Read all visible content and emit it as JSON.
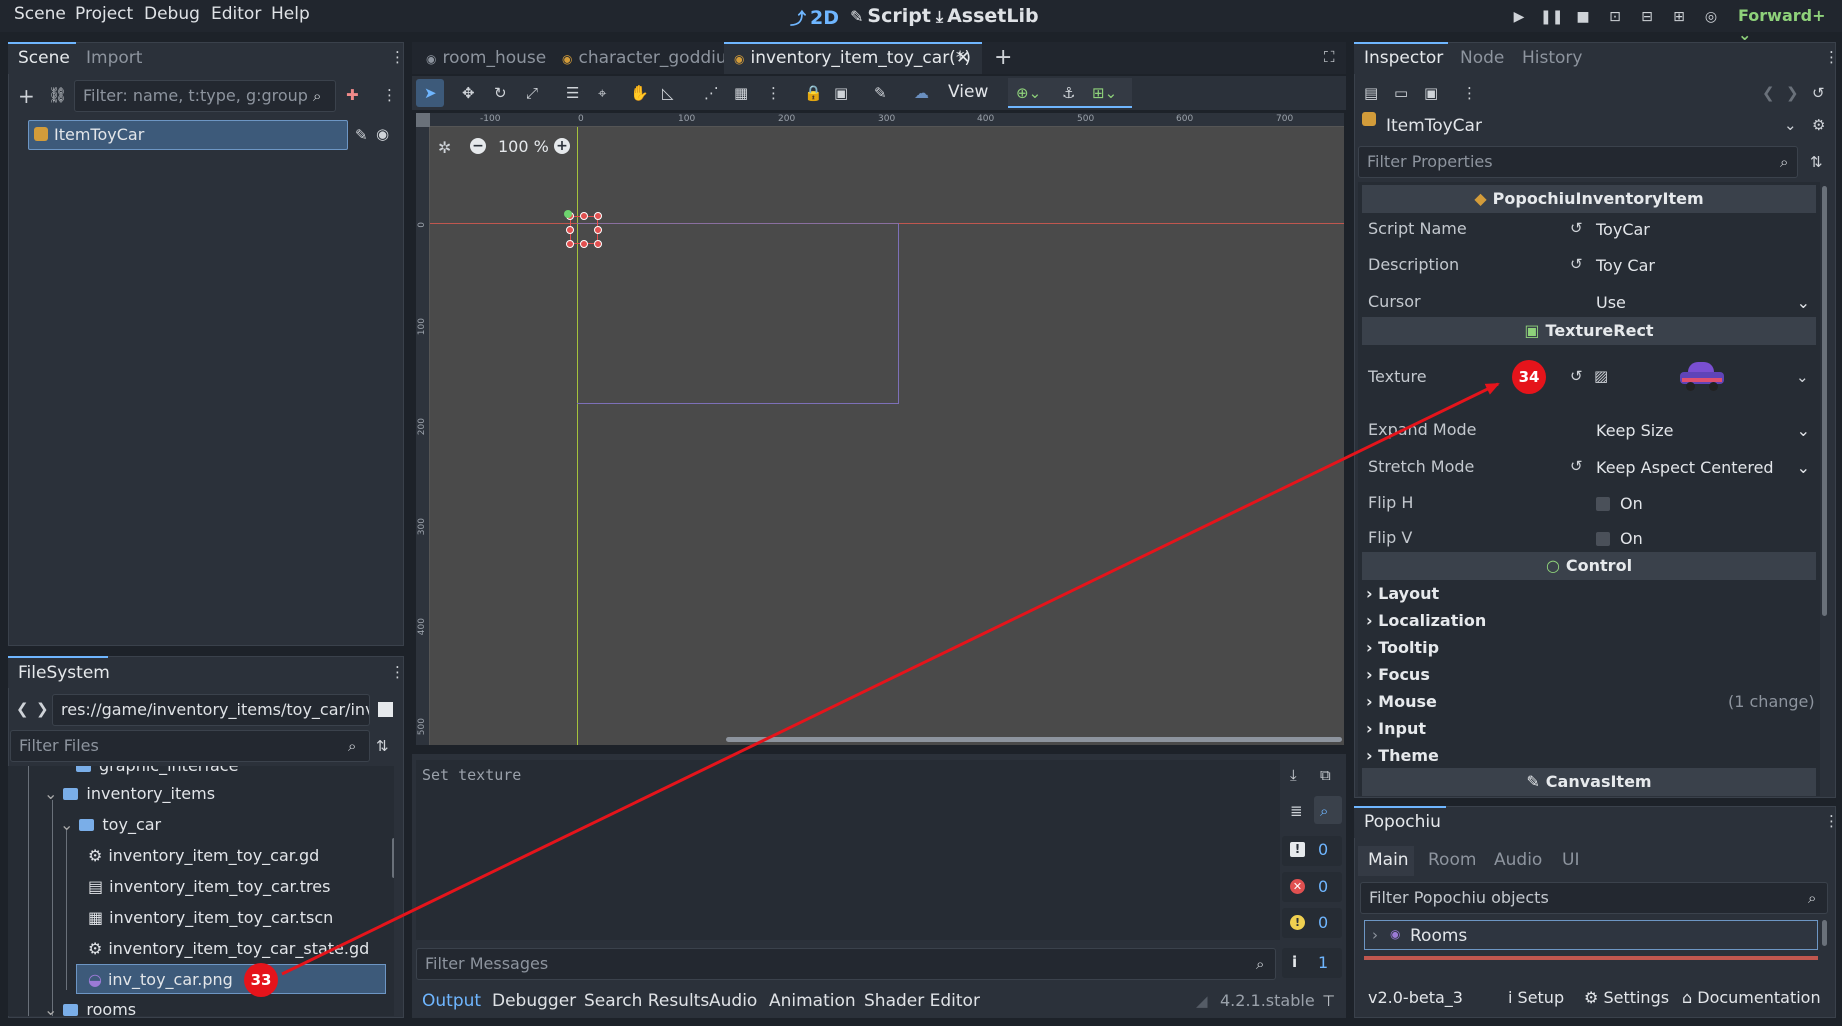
{
  "menu": [
    "Scene",
    "Project",
    "Debug",
    "Editor",
    "Help"
  ],
  "workspaces": [
    {
      "label": "2D",
      "icon": "2d-icon",
      "active": true
    },
    {
      "label": "Script",
      "icon": "script-icon",
      "active": false
    },
    {
      "label": "AssetLib",
      "icon": "assetlib-icon",
      "active": false
    }
  ],
  "renderer": "Forward+",
  "scene_dock": {
    "tabs": [
      "Scene",
      "Import"
    ],
    "filter_placeholder": "Filter: name, t:type, g:group",
    "root_node": "ItemToyCar"
  },
  "filesystem": {
    "title": "FileSystem",
    "path": "res://game/inventory_items/toy_car/inv_",
    "filter_placeholder": "Filter Files",
    "items": [
      {
        "label": "graphic_interface",
        "type": "folder"
      },
      {
        "label": "inventory_items",
        "type": "folder"
      },
      {
        "label": "toy_car",
        "type": "folder"
      },
      {
        "label": "inventory_item_toy_car.gd",
        "type": "script"
      },
      {
        "label": "inventory_item_toy_car.tres",
        "type": "resource"
      },
      {
        "label": "inventory_item_toy_car.tscn",
        "type": "scene"
      },
      {
        "label": "inventory_item_toy_car_state.gd",
        "type": "script"
      },
      {
        "label": "inv_toy_car.png",
        "type": "image",
        "selected": true
      },
      {
        "label": "rooms",
        "type": "folder"
      }
    ]
  },
  "editor_tabs": [
    {
      "label": "room_house",
      "active": false
    },
    {
      "label": "character_goddiu",
      "active": false
    },
    {
      "label": "inventory_item_toy_car(*)",
      "active": true
    }
  ],
  "toolbar": {
    "view_label": "View"
  },
  "zoom": "100 %",
  "ruler_h": [
    "-100",
    "0",
    "100",
    "200",
    "300",
    "400",
    "500",
    "600",
    "700"
  ],
  "ruler_v": [
    "0",
    "100",
    "200",
    "300",
    "400",
    "500"
  ],
  "output": {
    "text": "Set texture",
    "filter_placeholder": "Filter Messages",
    "counts": [
      "0",
      "0",
      "0",
      "1"
    ]
  },
  "bottom_tabs": [
    "Output",
    "Debugger",
    "Search Results",
    "Audio",
    "Animation",
    "Shader Editor"
  ],
  "version": "4.2.1.stable",
  "inspector": {
    "tabs": [
      "Inspector",
      "Node",
      "History"
    ],
    "node_name": "ItemToyCar",
    "filter_placeholder": "Filter Properties",
    "sections": {
      "popochiu": "PopochiuInventoryItem",
      "texture_rect": "TextureRect",
      "control": "Control",
      "canvas_item": "CanvasItem"
    },
    "props": {
      "script_name": {
        "label": "Script Name",
        "value": "ToyCar"
      },
      "description": {
        "label": "Description",
        "value": "Toy Car"
      },
      "cursor": {
        "label": "Cursor",
        "value": "Use"
      },
      "texture": {
        "label": "Texture"
      },
      "expand_mode": {
        "label": "Expand Mode",
        "value": "Keep Size"
      },
      "stretch_mode": {
        "label": "Stretch Mode",
        "value": "Keep Aspect Centered"
      },
      "flip_h": {
        "label": "Flip H",
        "value": "On"
      },
      "flip_v": {
        "label": "Flip V",
        "value": "On"
      }
    },
    "categories": [
      "Layout",
      "Localization",
      "Tooltip",
      "Focus",
      "Mouse",
      "Input",
      "Theme"
    ],
    "mouse_change": "(1 change)"
  },
  "popochiu": {
    "title": "Popochiu",
    "tabs": [
      "Main",
      "Room",
      "Audio",
      "UI"
    ],
    "filter_placeholder": "Filter Popochiu objects",
    "rooms_label": "Rooms",
    "version": "v2.0-beta_3",
    "footer": [
      "Setup",
      "Settings",
      "Documentation"
    ]
  },
  "annotations": {
    "badge_33": "33",
    "badge_34": "34",
    "arrow_color": "#e5141b"
  }
}
